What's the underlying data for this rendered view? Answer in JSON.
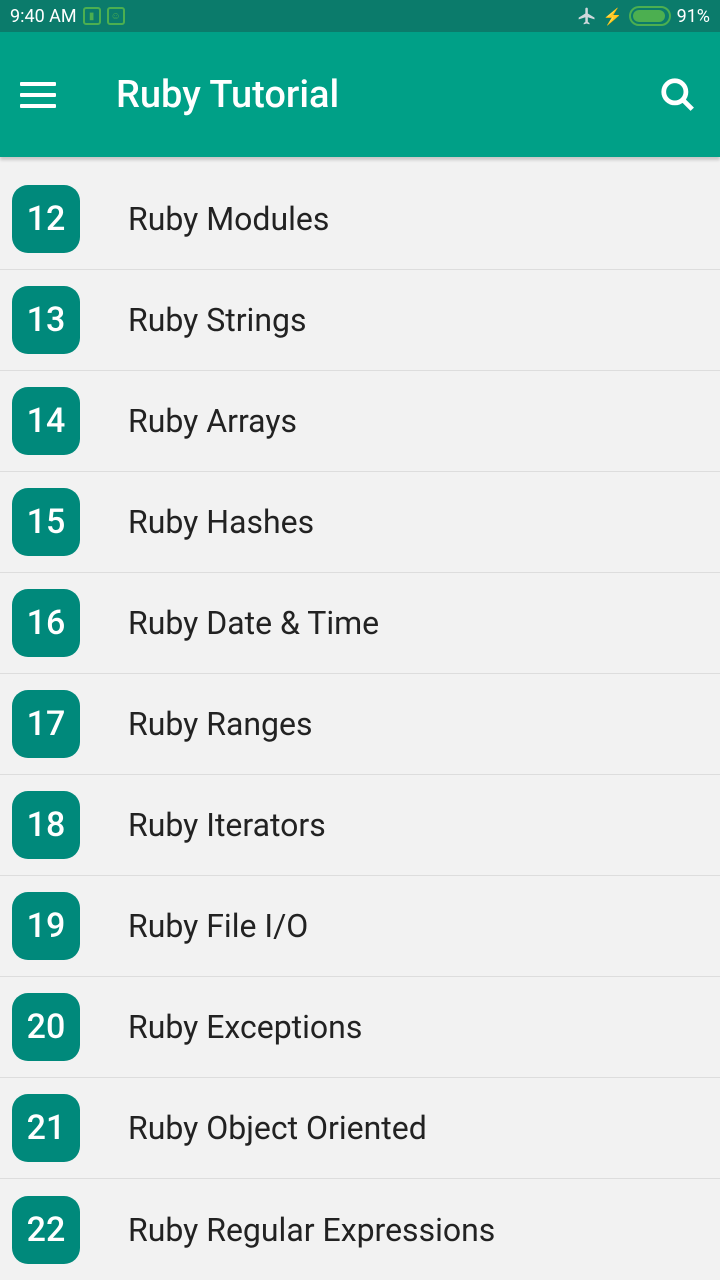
{
  "status": {
    "time": "9:40 AM",
    "battery_pct": "91%"
  },
  "header": {
    "title": "Ruby Tutorial"
  },
  "list": {
    "items": [
      {
        "num": "12",
        "label": "Ruby Modules"
      },
      {
        "num": "13",
        "label": "Ruby Strings"
      },
      {
        "num": "14",
        "label": "Ruby Arrays"
      },
      {
        "num": "15",
        "label": "Ruby Hashes"
      },
      {
        "num": "16",
        "label": "Ruby Date & Time"
      },
      {
        "num": "17",
        "label": "Ruby Ranges"
      },
      {
        "num": "18",
        "label": "Ruby Iterators"
      },
      {
        "num": "19",
        "label": "Ruby File I/O"
      },
      {
        "num": "20",
        "label": "Ruby Exceptions"
      },
      {
        "num": "21",
        "label": "Ruby Object Oriented"
      },
      {
        "num": "22",
        "label": "Ruby Regular Expressions"
      }
    ]
  }
}
